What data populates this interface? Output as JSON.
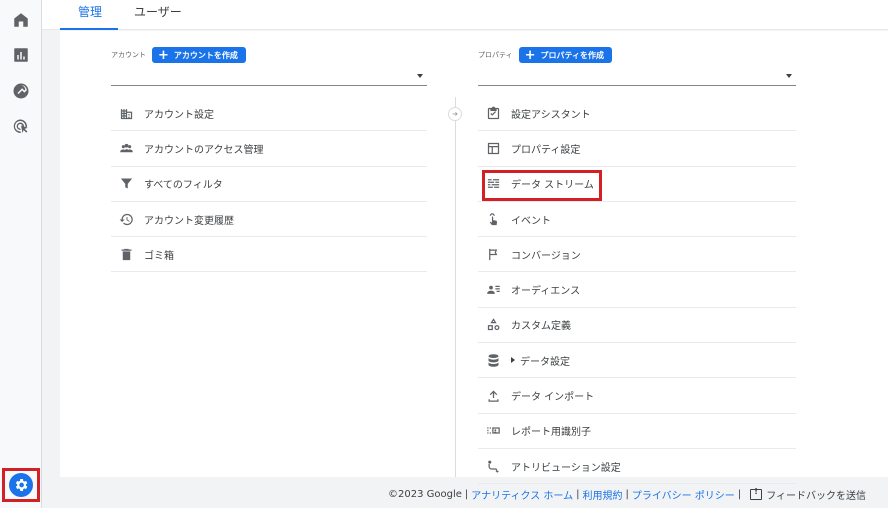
{
  "tabs": [
    {
      "label": "管理",
      "active": true
    },
    {
      "label": "ユーザー",
      "active": false
    }
  ],
  "rail": {
    "items": [
      "home-icon",
      "reports-icon",
      "explore-icon",
      "advertising-icon"
    ],
    "settings": "settings-icon"
  },
  "account": {
    "label": "アカウント",
    "create_label": "アカウントを作成",
    "selected": "",
    "items": [
      {
        "icon": "building-icon",
        "label": "アカウント設定"
      },
      {
        "icon": "people-icon",
        "label": "アカウントのアクセス管理"
      },
      {
        "icon": "filter-icon",
        "label": "すべてのフィルタ"
      },
      {
        "icon": "history-icon",
        "label": "アカウント変更履歴"
      },
      {
        "icon": "trash-icon",
        "label": "ゴミ箱"
      }
    ]
  },
  "property": {
    "label": "プロパティ",
    "create_label": "プロパティを作成",
    "selected": "",
    "items": [
      {
        "icon": "checklist-icon",
        "label": "設定アシスタント"
      },
      {
        "icon": "layout-icon",
        "label": "プロパティ設定"
      },
      {
        "icon": "data-stream-icon",
        "label": "データ ストリーム"
      },
      {
        "icon": "touch-icon",
        "label": "イベント"
      },
      {
        "icon": "flag-icon",
        "label": "コンバージョン"
      },
      {
        "icon": "audience-icon",
        "label": "オーディエンス"
      },
      {
        "icon": "shapes-icon",
        "label": "カスタム定義"
      },
      {
        "icon": "database-icon",
        "label": "データ設定"
      },
      {
        "icon": "upload-icon",
        "label": "データ インポート"
      },
      {
        "icon": "id-icon",
        "label": "レポート用識別子"
      },
      {
        "icon": "attribution-icon",
        "label": "アトリビューション設定"
      }
    ]
  },
  "footer": {
    "copyright": "©2023 Google",
    "links": [
      "アナリティクス ホーム",
      "利用規約",
      "プライバシー ポリシー"
    ],
    "feedback": "フィードバックを送信"
  },
  "colors": {
    "accent": "#1a73e8",
    "highlight": "#d32027"
  }
}
